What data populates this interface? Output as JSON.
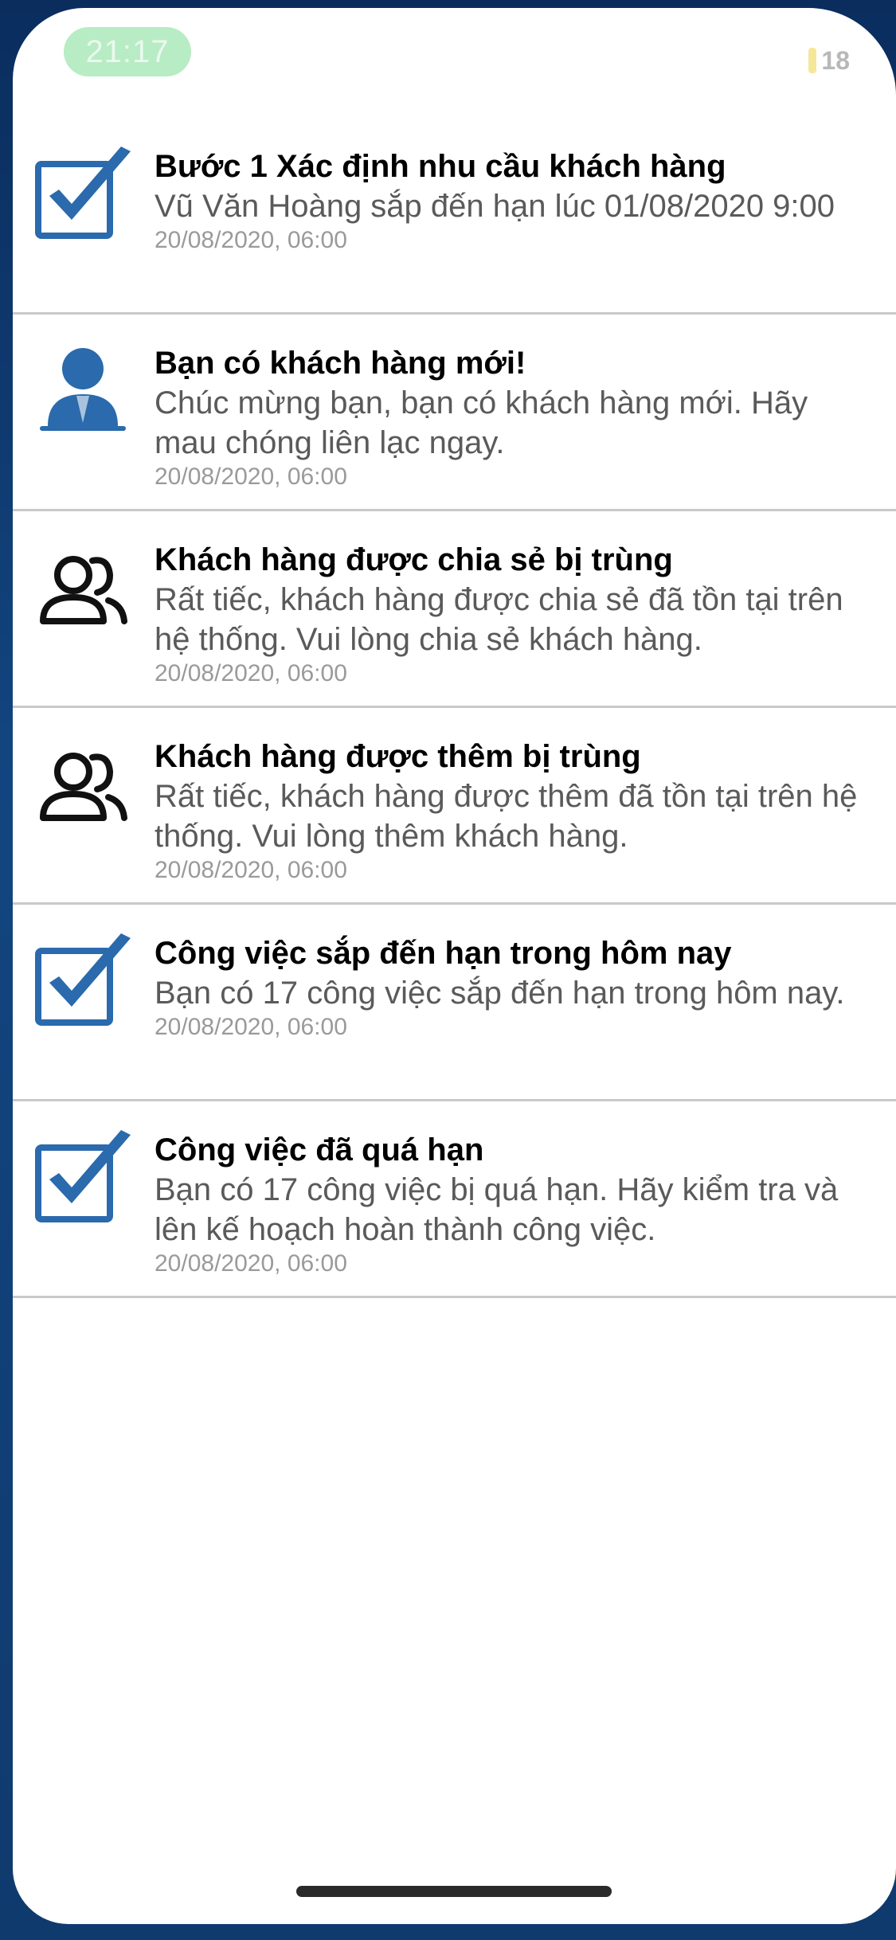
{
  "status_bar": {
    "time": "21:17",
    "battery": "18"
  },
  "colors": {
    "accent_blue": "#2a6aad",
    "status_time_bg": "#b8ecc4",
    "divider": "#c9c9c9"
  },
  "notifications": [
    {
      "icon": "checkbox-check-icon",
      "title": "Bước 1 Xác định nhu cầu khách hàng",
      "body": "Vũ Văn Hoàng sắp đến hạn lúc 01/08/2020 9:00",
      "time": "20/08/2020, 06:00"
    },
    {
      "icon": "user-avatar-icon",
      "title": "Bạn có khách hàng mới!",
      "body": "Chúc mừng bạn, bạn có khách hàng mới. Hãy mau chóng liên lạc ngay.",
      "time": "20/08/2020, 06:00"
    },
    {
      "icon": "users-group-icon",
      "title": "Khách hàng được chia sẻ bị trùng",
      "body": "Rất tiếc, khách hàng được chia sẻ đã tồn tại trên hệ thống. Vui lòng chia sẻ khách hàng.",
      "time": "20/08/2020, 06:00"
    },
    {
      "icon": "users-group-icon",
      "title": "Khách hàng được thêm bị trùng",
      "body": "Rất tiếc, khách hàng được thêm đã tồn tại trên hệ thống. Vui lòng thêm khách hàng.",
      "time": "20/08/2020, 06:00"
    },
    {
      "icon": "checkbox-check-icon",
      "title": "Công việc sắp đến hạn trong hôm nay",
      "body": "Bạn có 17 công việc sắp đến hạn trong hôm nay.",
      "time": "20/08/2020, 06:00"
    },
    {
      "icon": "checkbox-check-icon",
      "title": "Công việc đã quá hạn",
      "body": "Bạn có 17 công việc bị quá hạn. Hãy kiểm tra và lên kế hoạch hoàn thành công việc.",
      "time": "20/08/2020, 06:00"
    }
  ]
}
